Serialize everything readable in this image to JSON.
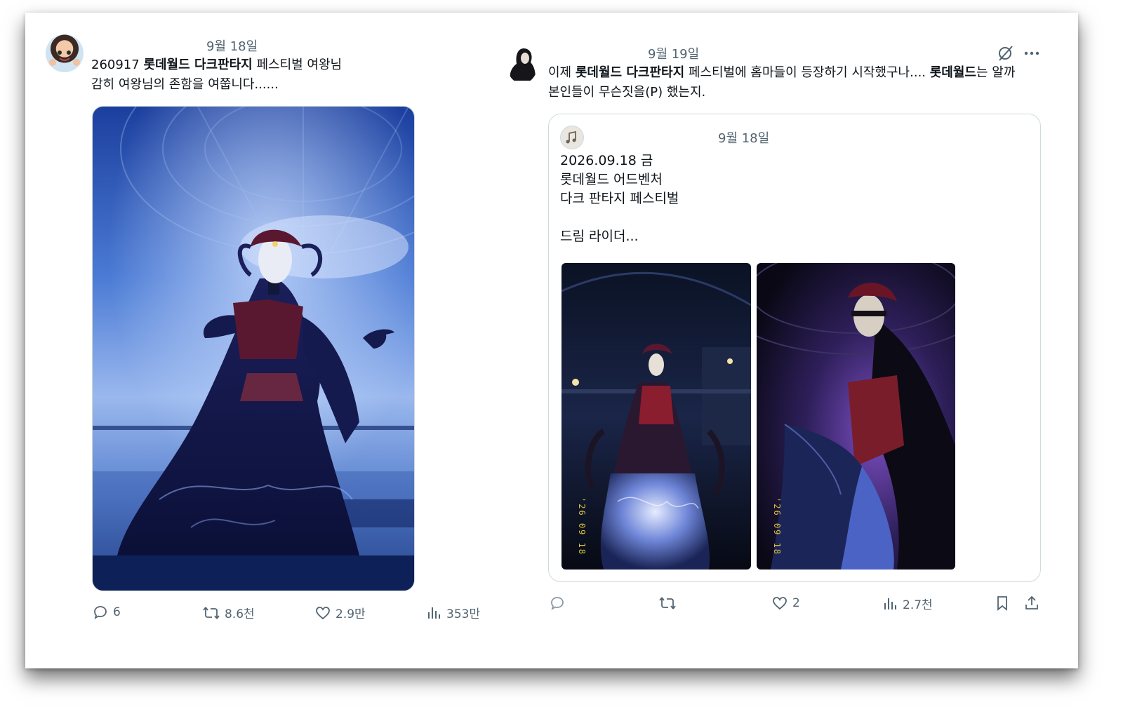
{
  "post_left": {
    "date": "9월 18일",
    "line1_prefix": "260917 ",
    "line1_bold": "롯데월드 다크판타지",
    "line1_suffix": " 페스티벌 여왕님",
    "line2": "감히 여왕님의 존함을 여쭙니다......",
    "actions": {
      "replies": "6",
      "reposts": "8.6천",
      "likes": "2.9만",
      "views": "353만"
    }
  },
  "post_right": {
    "date": "9월 19일",
    "line1_prefix": "이제 ",
    "line1_bold": "롯데월드 다크판타지",
    "line1_mid": " 페스티벌에 홈마들이 등장하기 시작했구나.... ",
    "line1_bold2": "롯데월드",
    "line1_suffix": "는 알까",
    "line2": "본인들이 무슨짓을(P) 했는지.",
    "actions": {
      "likes": "2",
      "views": "2.7천"
    },
    "quote": {
      "date": "9월 18일",
      "lines": [
        "2026.09.18 금",
        "롯데월드 어드벤처",
        "다크 판타지 페스티벌",
        "",
        "드림 라이더..."
      ],
      "photo_stamp": "'26 09 18"
    }
  },
  "colors": {
    "text": "#0f1419",
    "secondary": "#536471",
    "border": "#cfd9de"
  }
}
